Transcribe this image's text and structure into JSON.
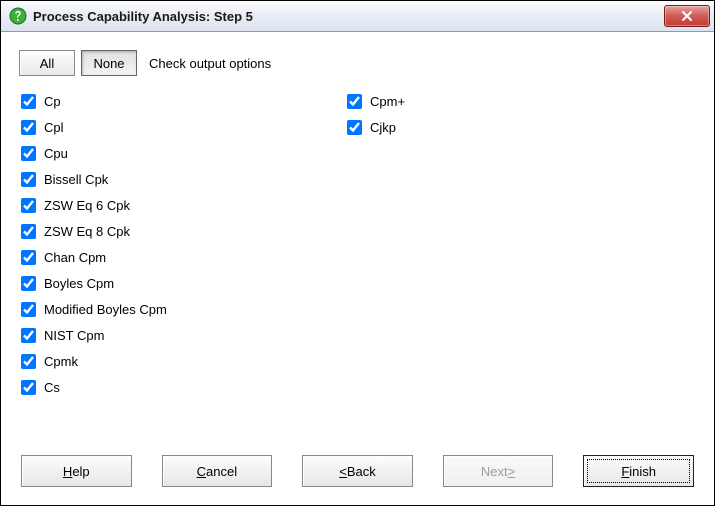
{
  "window": {
    "title": "Process Capability Analysis: Step 5"
  },
  "icons": {
    "app": "question-mark-icon",
    "close": "close-icon"
  },
  "toolbar": {
    "all_label": "All",
    "none_label": "None",
    "instruction": "Check output options"
  },
  "options": {
    "left": [
      {
        "label": "Cp",
        "checked": true
      },
      {
        "label": "Cpl",
        "checked": true
      },
      {
        "label": "Cpu",
        "checked": true
      },
      {
        "label": "Bissell Cpk",
        "checked": true
      },
      {
        "label": "ZSW Eq 6 Cpk",
        "checked": true
      },
      {
        "label": "ZSW Eq 8 Cpk",
        "checked": true
      },
      {
        "label": "Chan Cpm",
        "checked": true
      },
      {
        "label": "Boyles Cpm",
        "checked": true
      },
      {
        "label": "Modified Boyles Cpm",
        "checked": true
      },
      {
        "label": "NIST Cpm",
        "checked": true
      },
      {
        "label": "Cpmk",
        "checked": true
      },
      {
        "label": "Cs",
        "checked": true
      }
    ],
    "right": [
      {
        "label": "Cpm+",
        "checked": true
      },
      {
        "label": "Cjkp",
        "checked": true
      }
    ]
  },
  "buttons": {
    "help": {
      "full": "Help",
      "prefix": "",
      "mn": "H",
      "suffix": "elp",
      "enabled": true,
      "default": false
    },
    "cancel": {
      "full": "Cancel",
      "prefix": "",
      "mn": "C",
      "suffix": "ancel",
      "enabled": true,
      "default": false
    },
    "back": {
      "full": "< Back",
      "prefix": "",
      "mn": "<",
      "suffix": " Back",
      "enabled": true,
      "default": false
    },
    "next": {
      "full": "Next >",
      "prefix": "Next ",
      "mn": ">",
      "suffix": "",
      "enabled": false,
      "default": false
    },
    "finish": {
      "full": "Finish",
      "prefix": "",
      "mn": "F",
      "suffix": "inish",
      "enabled": true,
      "default": true
    }
  }
}
